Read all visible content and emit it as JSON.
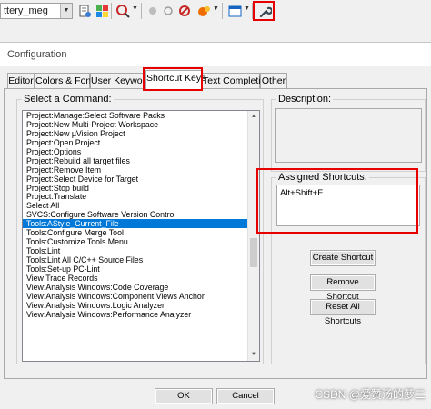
{
  "toolbar": {
    "target_combo_value": "ttery_meg",
    "icons": [
      "target-options-icon",
      "manage-components-icon",
      "debug-session-icon",
      "breakpoint-insert-icon",
      "breakpoint-enable-icon",
      "breakpoint-kill-icon",
      "breakpoint-disable-icon",
      "window-layout-icon",
      "configuration-wrench-icon"
    ],
    "highlight_color": "#e60000"
  },
  "dialog": {
    "title": "Configuration",
    "tabs": [
      {
        "label": "Editor"
      },
      {
        "label": "Colors & Fonts"
      },
      {
        "label": "User Keywords"
      },
      {
        "label": "Shortcut Keys"
      },
      {
        "label": "Text Completion"
      },
      {
        "label": "Other"
      }
    ],
    "active_tab": "Shortcut Keys",
    "select_command_label": "Select a Command:",
    "commands": [
      "Project:Manage:Select Software Packs",
      "Project:New Multi-Project Workspace",
      "Project:New µVision Project",
      "Project:Open Project",
      "Project:Options",
      "Project:Rebuild all target files",
      "Project:Remove Item",
      "Project:Select Device for Target",
      "Project:Stop build",
      "Project:Translate",
      "Select All",
      "SVCS:Configure Software Version Control",
      "Tools:AStyle_Current_File",
      "Tools:Configure Merge Tool",
      "Tools:Customize Tools Menu",
      "Tools:Lint",
      "Tools:Lint All C/C++ Source Files",
      "Tools:Set-up PC-Lint",
      "View Trace Records",
      "View:Analysis Windows:Code Coverage",
      "View:Analysis Windows:Component Views Anchor",
      "View:Analysis Windows:Logic Analyzer",
      "View:Analysis Windows:Performance Analyzer"
    ],
    "selected_command": "Tools:AStyle_Current_File",
    "description_label": "Description:",
    "description_text": "",
    "assigned_shortcuts_label": "Assigned Shortcuts:",
    "assigned_shortcut": "Alt+Shift+F",
    "buttons": {
      "create": "Create Shortcut",
      "remove": "Remove Shortcut",
      "reset": "Reset All Shortcuts",
      "ok": "OK",
      "cancel": "Cancel"
    },
    "selection_color": "#0078d7"
  },
  "watermark": "CSDN @爱赞汤的萝二"
}
